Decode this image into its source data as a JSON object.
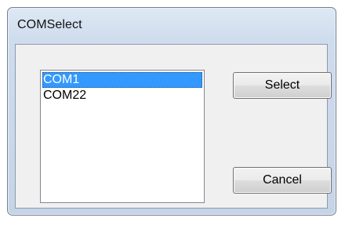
{
  "window": {
    "title": "COMSelect"
  },
  "listbox": {
    "items": [
      {
        "label": "COM1",
        "selected": true
      },
      {
        "label": "COM22",
        "selected": false
      }
    ]
  },
  "buttons": {
    "select_label": "Select",
    "cancel_label": "Cancel"
  },
  "colors": {
    "selection": "#3399ff",
    "titlebar": "#cfdced",
    "client_background": "#f0f0f0"
  }
}
